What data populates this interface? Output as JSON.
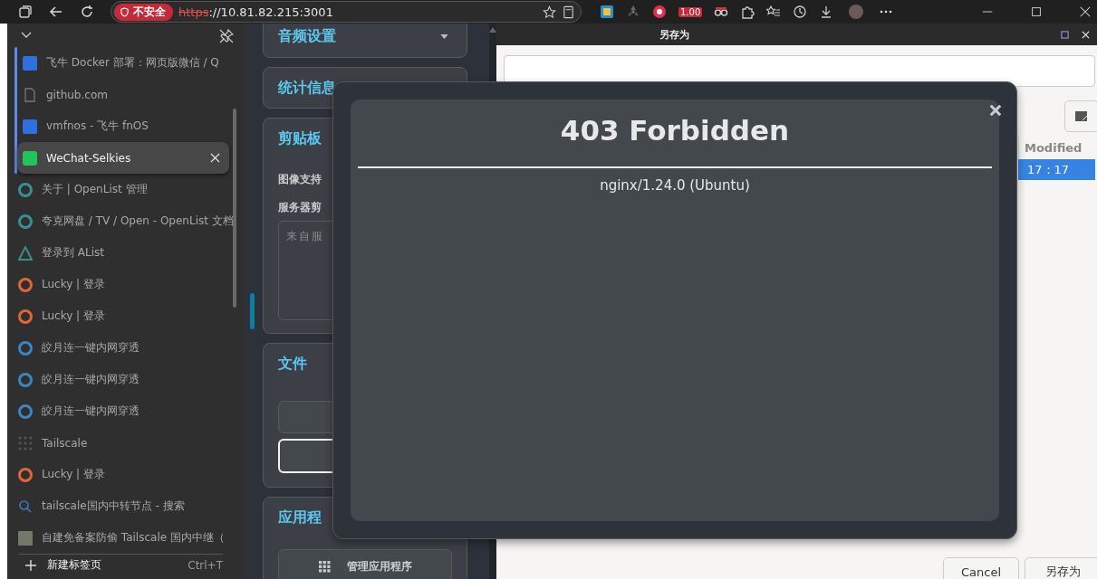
{
  "browser": {
    "security_label": "不安全",
    "url_scheme": "https",
    "url_rest": "://10.81.82.215:3001",
    "extension_badge": "1.00"
  },
  "tab_sidebar": {
    "tab_group": {
      "color": "#5b8def",
      "tabs": [
        {
          "title": "飞牛 Docker 部署：网页版微信 / Q",
          "kind": "fn",
          "selected": false
        },
        {
          "title": "github.com",
          "kind": "file",
          "selected": false
        },
        {
          "title": "vmfnos - 飞牛 fnOS",
          "kind": "fn",
          "selected": false
        },
        {
          "title": "WeChat-Selkies",
          "kind": "wechat",
          "selected": true
        }
      ]
    },
    "tabs": [
      {
        "title": "关于 | OpenList 管理",
        "kind": "openlist",
        "selected": false
      },
      {
        "title": "夸克网盘 / TV / Open - OpenList 文档",
        "kind": "openlist",
        "selected": false
      },
      {
        "title": "登录到 AList",
        "kind": "alist",
        "selected": false
      },
      {
        "title": "Lucky | 登录",
        "kind": "lucky",
        "selected": false
      },
      {
        "title": "Lucky | 登录",
        "kind": "lucky",
        "selected": false
      },
      {
        "title": "皎月连一键内网穿透",
        "kind": "moon",
        "selected": false
      },
      {
        "title": "皎月连一键内网穿透",
        "kind": "moon",
        "selected": false
      },
      {
        "title": "皎月连一键内网穿透",
        "kind": "moon",
        "selected": false
      },
      {
        "title": "Tailscale",
        "kind": "dots",
        "selected": false
      },
      {
        "title": "Lucky | 登录",
        "kind": "lucky",
        "selected": false
      },
      {
        "title": "tailscale国内中转节点 - 搜索",
        "kind": "search",
        "selected": false
      },
      {
        "title": "自建免备案防偷 Tailscale 国内中继（",
        "kind": "thumb",
        "selected": false
      }
    ],
    "new_tab": {
      "label": "新建标签页",
      "shortcut": "Ctrl+T"
    }
  },
  "settings_panel": {
    "sections": [
      {
        "kind": "collapsed",
        "title": "音频设置"
      },
      {
        "kind": "collapsed",
        "title": "统计信息"
      },
      {
        "kind": "clipboard",
        "title": "剪贴板",
        "labels": [
          "图像支持",
          "服务器剪"
        ],
        "placeholder": "来自服"
      },
      {
        "kind": "files",
        "title": "文件",
        "buttons": [
          {
            "focused": false
          },
          {
            "focused": true
          }
        ]
      },
      {
        "kind": "apps",
        "title": "应用程",
        "button": "管理应用程序"
      }
    ]
  },
  "save_dialog": {
    "title": "另存为",
    "column": "Modified",
    "row_time": "17：17",
    "row_selected": true,
    "buttons": [
      "Cancel",
      "另存为"
    ]
  },
  "error_modal": {
    "heading": "403 Forbidden",
    "server": "nginx/1.24.0 (Ubuntu)"
  }
}
